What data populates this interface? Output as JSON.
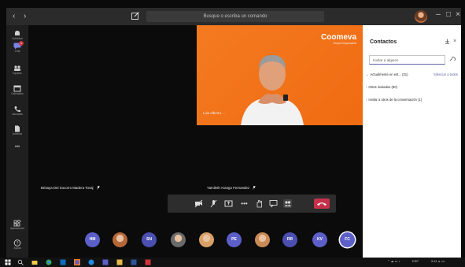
{
  "titlebar": {
    "back_glyph": "‹",
    "forward_glyph": "›",
    "search_placeholder": "Busque o escriba un comando",
    "min_glyph": "–",
    "max_glyph": "□",
    "close_glyph": "×"
  },
  "rail": {
    "items": [
      {
        "label": "Actividad",
        "icon": "bell-icon"
      },
      {
        "label": "Chat",
        "icon": "chat-icon",
        "badge": "1",
        "active": true
      },
      {
        "label": "Equipos",
        "icon": "teams-icon"
      },
      {
        "label": "Calendario",
        "icon": "calendar-icon"
      },
      {
        "label": "Llamadas",
        "icon": "phone-icon"
      },
      {
        "label": "Archivos",
        "icon": "files-icon"
      },
      {
        "label": "Aplicaciones",
        "icon": "apps-icon"
      },
      {
        "label": "Ayuda",
        "icon": "help-icon"
      }
    ],
    "more_glyph": "•••"
  },
  "stage": {
    "presenter": {
      "name": "Luis Alberto ...",
      "logo_text": "Coomeva",
      "logo_sub": "Grupo Empresarial"
    },
    "participants": [
      {
        "name": "Brisaya Del Socorro Madera Tovaj"
      },
      {
        "name": "Yamileth Arango Fernandez"
      }
    ]
  },
  "callbar": {
    "timer": "",
    "more_glyph": "•••"
  },
  "strip": {
    "avatars": [
      {
        "initials": "HM",
        "color": "#5b5fc7"
      },
      {
        "photo": true,
        "color": "#b5673a"
      },
      {
        "initials": "SN",
        "color": "#4b4fb0"
      },
      {
        "photo": true,
        "color": "#6b6b6b"
      },
      {
        "photo": true,
        "color": "#d9a066"
      },
      {
        "initials": "PE",
        "color": "#5b5fc7"
      },
      {
        "photo": true,
        "color": "#c98a55"
      },
      {
        "initials": "RR",
        "color": "#4b4fb0"
      },
      {
        "initials": "KV",
        "color": "#5b5fc7"
      },
      {
        "initials": "FC",
        "color": "#5b5fc7"
      }
    ]
  },
  "panel": {
    "title": "Contactos",
    "invite_placeholder": "Invitar a alguien",
    "sections": [
      {
        "label": "Actualmente en est... (31)"
      },
      {
        "label": "Otros invitados (80)"
      },
      {
        "label": "Invitar a otros de la conversación (1)"
      }
    ],
    "mute_all": "Silenciar a todos"
  },
  "taskbar": {
    "lang": "ESP",
    "time": "9:41 a. m."
  },
  "colors": {
    "accent": "#5b5fc7",
    "hangup": "#c4314b",
    "presenter_bg": "#f47a20"
  }
}
